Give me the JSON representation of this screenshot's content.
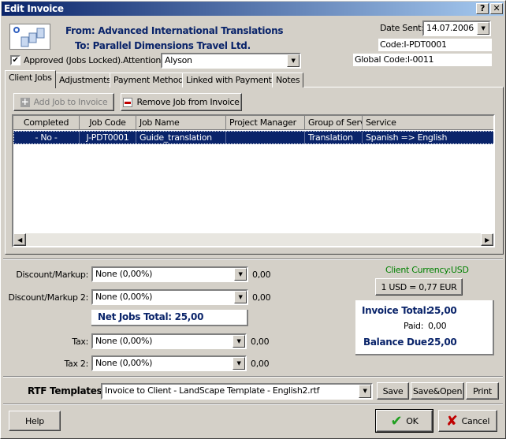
{
  "window": {
    "title": "Edit Invoice",
    "help_btn": "?",
    "close_btn": "✕"
  },
  "header": {
    "from": "From: Advanced International Translations",
    "to": "To: Parallel Dimensions Travel Ltd.",
    "date_sent_label": "Date Sent:",
    "date_sent": "14.07.2006",
    "code": "Code:I-PDT0001",
    "global_code": "Global Code:I-0011",
    "approved_label": "Approved (Jobs Locked).",
    "approved": true,
    "attention_label": "Attention:",
    "attention": "Alyson"
  },
  "tabs": [
    {
      "label": "Client Jobs",
      "active": true
    },
    {
      "label": "Adjustments"
    },
    {
      "label": "Payment Method"
    },
    {
      "label": "Linked with Payments"
    },
    {
      "label": "Notes"
    }
  ],
  "toolbar": {
    "add_job": "Add Job to Invoice",
    "remove_job": "Remove Job from Invoice"
  },
  "grid": {
    "columns": [
      "Completed",
      "Job Code",
      "Job Name",
      "Project Manager",
      "Group of Servi",
      "Service"
    ],
    "rows": [
      [
        "- No -",
        "J-PDT0001",
        "Guide_translation",
        "",
        "Translation",
        "Spanish => English"
      ]
    ]
  },
  "totals": {
    "discount_label": "Discount/Markup:",
    "discount": "None (0,00%)",
    "discount_value": "0,00",
    "discount2_label": "Discount/Markup 2:",
    "discount2": "None (0,00%)",
    "discount2_value": "0,00",
    "net_jobs_total": "Net Jobs Total: 25,00",
    "tax_label": "Tax:",
    "tax": "None (0,00%)",
    "tax_value": "0,00",
    "tax2_label": "Tax 2:",
    "tax2": "None (0,00%)",
    "tax2_value": "0,00",
    "client_currency": "Client Currency:USD",
    "rate": "1 USD = 0,77 EUR",
    "invoice_total_label": "Invoice Total:",
    "invoice_total": "25,00",
    "paid_label": "Paid:",
    "paid": "0,00",
    "balance_due_label": "Balance Due:",
    "balance_due": "25,00"
  },
  "rtf": {
    "label": "RTF Templates:",
    "template": "Invoice to Client - LandScape Template - English2.rtf",
    "save": "Save",
    "save_open": "Save&Open",
    "print": "Print"
  },
  "footer": {
    "help": "Help",
    "ok": "OK",
    "cancel": "Cancel"
  },
  "colors": {
    "title_start": "#0a246a",
    "title_end": "#a6caf0",
    "selection": "#0a246a",
    "currency": "#008000"
  }
}
